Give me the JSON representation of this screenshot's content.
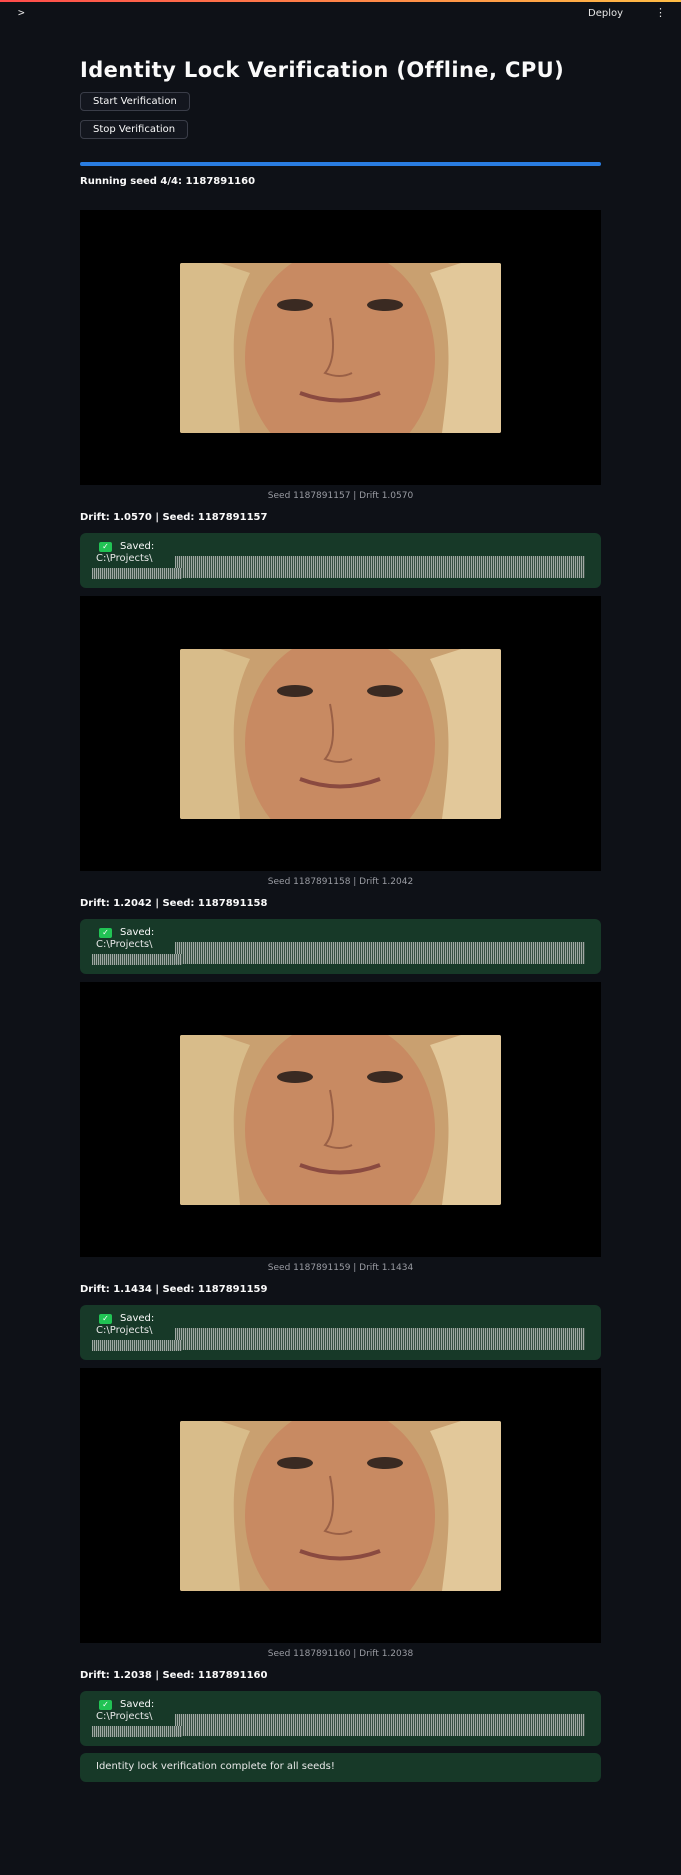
{
  "header": {
    "sidebar_toggle": ">",
    "deploy_label": "Deploy",
    "menu_glyph": "⋮",
    "accent_gradient": [
      "#ff4b4b",
      "#ffbd45"
    ]
  },
  "page": {
    "title": "Identity Lock Verification (Offline, CPU)",
    "start_button": "Start Verification",
    "stop_button": "Stop Verification",
    "progress": 1.0,
    "progress_color": "#2a7de1",
    "status": "Running seed 4/4: 1187891160"
  },
  "results": [
    {
      "caption": "Seed 1187891157 | Drift 1.0570",
      "drift_line": "Drift: 1.0570 | Seed: 1187891157",
      "saved_label": "Saved:",
      "saved_path": "C:\\Projects\\"
    },
    {
      "caption": "Seed 1187891158 | Drift 1.2042",
      "drift_line": "Drift: 1.2042 | Seed: 1187891158",
      "saved_label": "Saved:",
      "saved_path": "C:\\Projects\\"
    },
    {
      "caption": "Seed 1187891159 | Drift 1.1434",
      "drift_line": "Drift: 1.1434 | Seed: 1187891159",
      "saved_label": "Saved:",
      "saved_path": "C:\\Projects\\"
    },
    {
      "caption": "Seed 1187891160 | Drift 1.2038",
      "drift_line": "Drift: 1.2038 | Seed: 1187891160",
      "saved_label": "Saved:",
      "saved_path": "C:\\Projects\\"
    }
  ],
  "complete_message": "Identity lock verification complete for all seeds!",
  "icons": {
    "saved": "check-icon"
  },
  "colors": {
    "background": "#0e1117",
    "success_bg": "#173928",
    "success_icon": "#21c354"
  }
}
